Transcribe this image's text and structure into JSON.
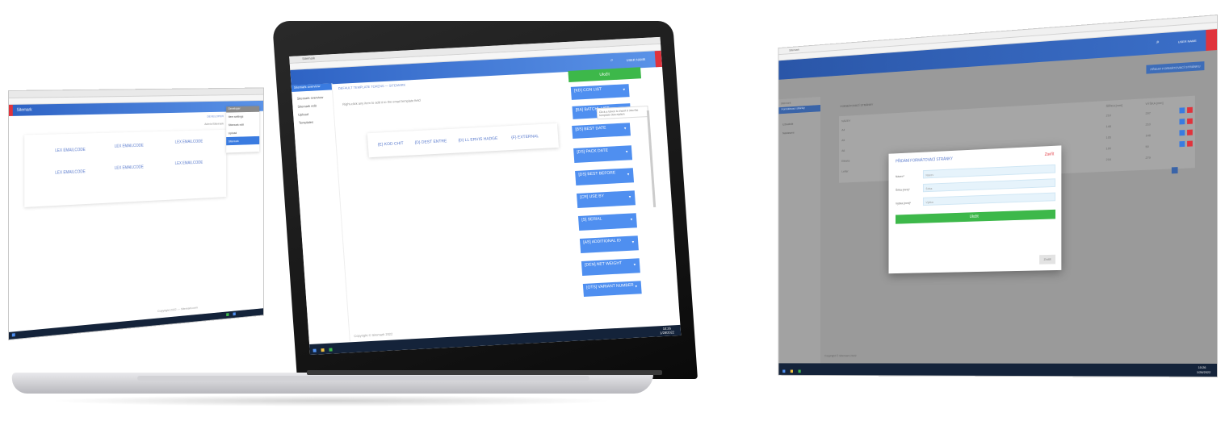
{
  "left": {
    "brand": "Sitemark",
    "user_label": "DEVELOPER",
    "user_sub": "Admin/Sitemark",
    "nav_boxes": [
      "LEX EMAILCODE",
      "LEX EMAILCODE",
      "LEX EMAILCODE",
      "LEX EMAILCODE",
      "LEX EMAILCODE",
      "LEX EMAILCODE"
    ],
    "dropdown_title": "Developer",
    "dropdown_items": [
      "Item settings",
      "Sitemark edit",
      "Upload",
      "Sitemark"
    ],
    "footer": "Copyright 2022 — Sitemark.com"
  },
  "middle": {
    "tab_title": "Sitemark",
    "username": "USER NAME",
    "sidebar": {
      "active": "Sitemark overview",
      "items": [
        "Sitemark overview",
        "Sitemark edit",
        "Upload",
        "Templates"
      ]
    },
    "breadcrumb": "DEFAULT TEMPLATE TOKENS — SITEMARK",
    "info_note": "Right-click any item to add it to the email template field",
    "save_button": "Uložit",
    "tokens": [
      "{E} KOD CHIT",
      "{D} DEST ENTRE",
      "{D} LL ERVIS HADGE",
      "{F} EXTERNAL"
    ],
    "side_buttons": [
      "[KD] CON LIST",
      "[BA] BATCHL LIST",
      "[BS] BEST DATE",
      "[DS] PACK DATE",
      "[DS] BEST BEFORE",
      "[CR] USE BY",
      "[S] SERIAL",
      "[AS] ADDITIONAL ID",
      "[DEN] NET WEIGHT",
      "[OTS] VARIANT NUMBER"
    ],
    "tooltip": "Click a token to insert it into the template description",
    "footer": "Copyright © Sitemark 2022",
    "tray_time": "10:26",
    "tray_date": "1/28/2022"
  },
  "right": {
    "tab_title": "Sitemark",
    "username": "USER NAME",
    "top_action": "PŘIDAT FORMÁTOVACÍ STRÁNKU",
    "sidebar": {
      "header": "Sitemark",
      "active": "Formátovací stránky",
      "items": [
        "Formátovací stránky",
        "Uživatelé",
        "Nastavení"
      ]
    },
    "breadcrumb": "FORMÁTOVACÍ STRÁNKY",
    "table": {
      "headers": [
        "NÁZEV",
        "ŠÍŘKA [mm]",
        "VÝŠKA [mm]"
      ],
      "rows": [
        [
          "A4",
          "210",
          "297"
        ],
        [
          "A5",
          "148",
          "210"
        ],
        [
          "A6",
          "105",
          "148"
        ],
        [
          "Etiketa",
          "100",
          "50"
        ],
        [
          "Letter",
          "216",
          "279"
        ]
      ]
    },
    "footer": "Copyright © Sitemark 2022",
    "modal": {
      "title": "PŘIDÁNÍ FORMÁTOVACÍ STRÁNKY",
      "close": "Zavřít",
      "fields": [
        {
          "label": "Název*",
          "placeholder": "Název"
        },
        {
          "label": "Šířka [mm]*",
          "placeholder": "Šířka"
        },
        {
          "label": "Výška [mm]*",
          "placeholder": "Výška"
        }
      ],
      "save_button": "Uložit",
      "cancel_button": "Zrušit"
    },
    "tray_time": "10:26",
    "tray_date": "1/28/2022"
  },
  "colors": {
    "primary_blue": "#4f8ff0",
    "app_bar": "#2e63c4",
    "accent_red": "#e0333c",
    "save_green": "#3db84a",
    "taskbar": "#14233a"
  }
}
